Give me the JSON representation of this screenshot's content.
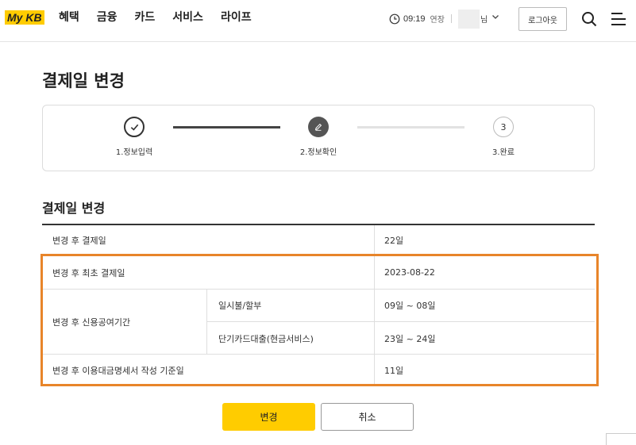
{
  "header": {
    "logo": "My KB",
    "nav": [
      "혜택",
      "금융",
      "카드",
      "서비스",
      "라이프"
    ],
    "session_time": "09:19",
    "extend_label": "연장",
    "user_suffix": "님",
    "logout_label": "로그아웃"
  },
  "page": {
    "title": "결제일 변경"
  },
  "stepper": {
    "steps": [
      {
        "number": "1",
        "label": "1.정보입력",
        "state": "done"
      },
      {
        "number": "2",
        "label": "2.정보확인",
        "state": "current"
      },
      {
        "number": "3",
        "label": "3.완료",
        "state": "pending"
      }
    ]
  },
  "section": {
    "title": "결제일 변경",
    "rows": {
      "payment_day": {
        "label": "변경 후 결제일",
        "value": "22일"
      },
      "first_payment": {
        "label": "변경 후 최초 결제일",
        "value": "2023-08-22"
      },
      "credit_period": {
        "label": "변경 후 신용공여기간",
        "sub": [
          {
            "label": "일시불/할부",
            "value": "09일 ~ 08일"
          },
          {
            "label": "단기카드대출(현금서비스)",
            "value": "23일 ~ 24일"
          }
        ]
      },
      "statement_day": {
        "label": "변경 후 이용대금명세서 작성 기준일",
        "value": "11일"
      }
    }
  },
  "actions": {
    "confirm_label": "변경",
    "cancel_label": "취소"
  },
  "colors": {
    "brand_yellow": "#ffcc00",
    "highlight_orange": "#e8852a",
    "step_dark": "#555555"
  }
}
